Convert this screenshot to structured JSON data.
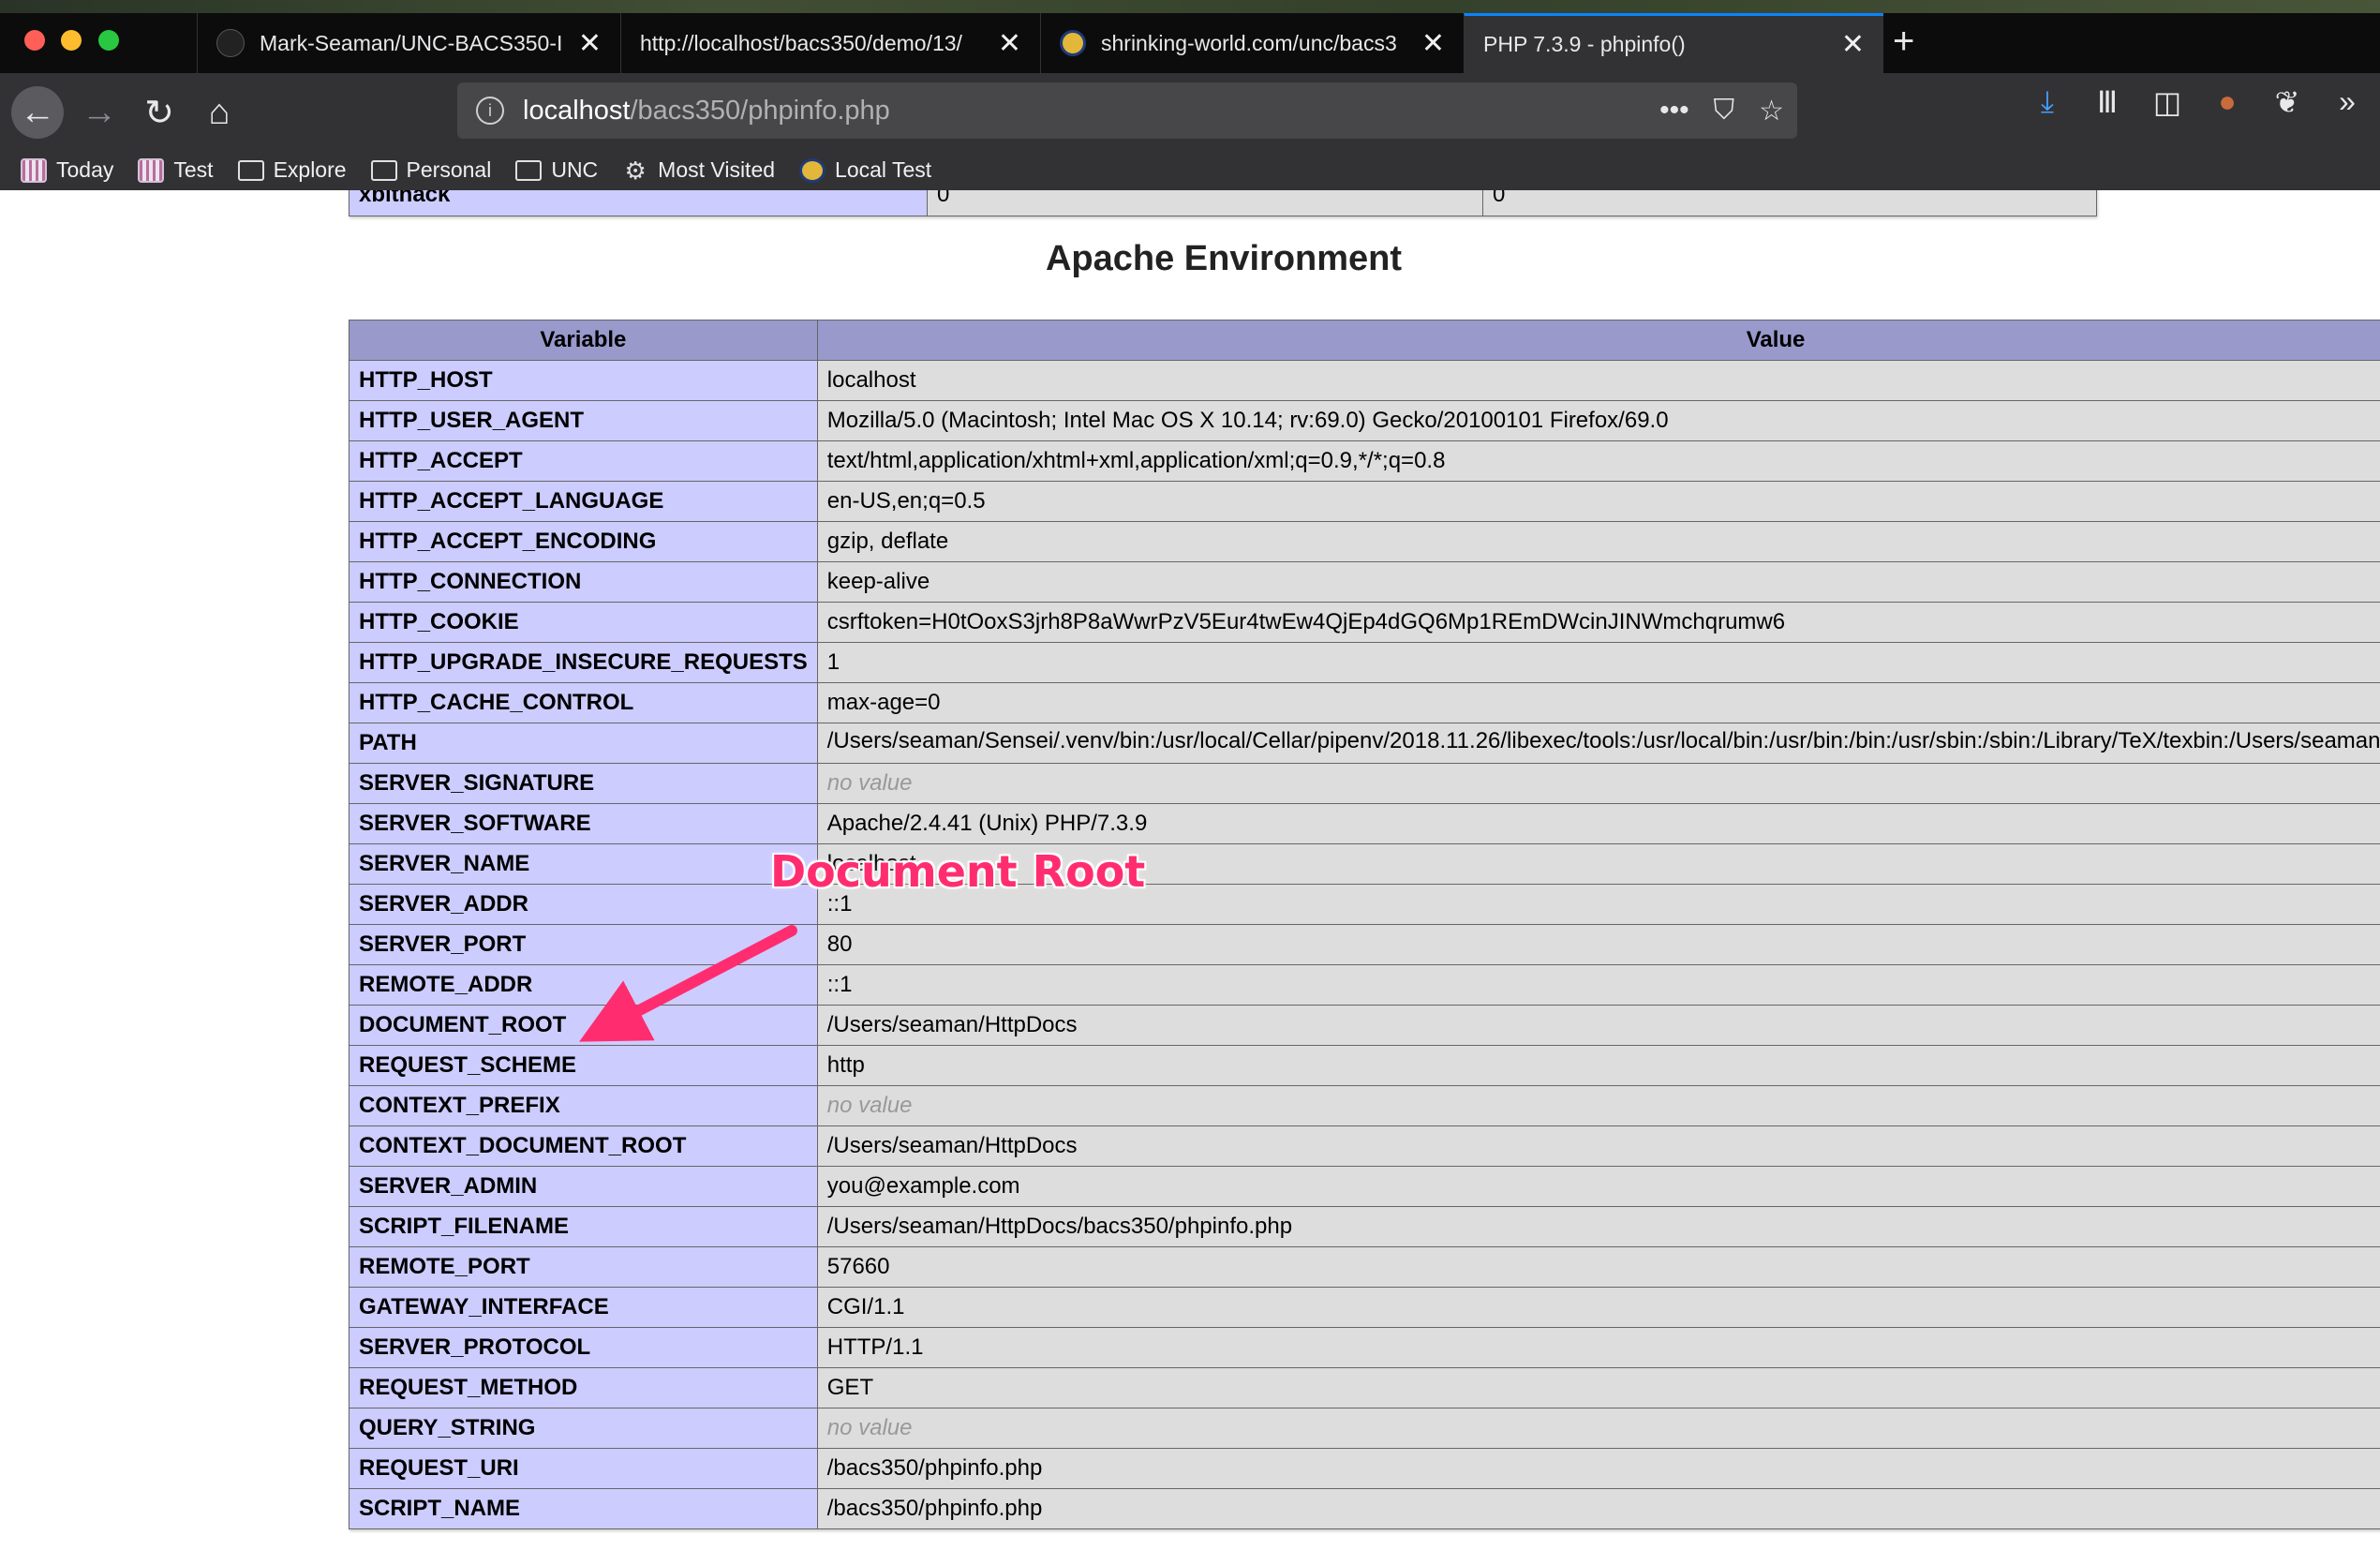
{
  "browser": {
    "tabs": [
      {
        "title": "Mark-Seaman/UNC-BACS350-I",
        "close": "✕"
      },
      {
        "title": "http://localhost/bacs350/demo/13/",
        "close": "✕"
      },
      {
        "title": "shrinking-world.com/unc/bacs3",
        "close": "✕"
      },
      {
        "title": "PHP 7.3.9 - phpinfo()",
        "close": "✕",
        "active": true
      }
    ],
    "new_tab": "+",
    "url_host": "localhost",
    "url_path": "/bacs350/phpinfo.php",
    "bookmarks": [
      {
        "label": "Today",
        "icon": "globe-icon"
      },
      {
        "label": "Test",
        "icon": "globe-icon"
      },
      {
        "label": "Explore",
        "icon": "folder-icon"
      },
      {
        "label": "Personal",
        "icon": "folder-icon"
      },
      {
        "label": "UNC",
        "icon": "folder-icon"
      },
      {
        "label": "Most Visited",
        "icon": "gear-icon"
      },
      {
        "label": "Local Test",
        "icon": "badge-icon"
      }
    ]
  },
  "prev_row": {
    "name": "xbithack",
    "local": "0",
    "master": "0"
  },
  "section": {
    "title": "Apache Environment"
  },
  "table": {
    "headers": [
      "Variable",
      "Value"
    ],
    "rows": [
      {
        "name": "HTTP_HOST",
        "value": "localhost"
      },
      {
        "name": "HTTP_USER_AGENT",
        "value": "Mozilla/5.0 (Macintosh; Intel Mac OS X 10.14; rv:69.0) Gecko/20100101 Firefox/69.0"
      },
      {
        "name": "HTTP_ACCEPT",
        "value": "text/html,application/xhtml+xml,application/xml;q=0.9,*/*;q=0.8"
      },
      {
        "name": "HTTP_ACCEPT_LANGUAGE",
        "value": "en-US,en;q=0.5"
      },
      {
        "name": "HTTP_ACCEPT_ENCODING",
        "value": "gzip, deflate"
      },
      {
        "name": "HTTP_CONNECTION",
        "value": "keep-alive"
      },
      {
        "name": "HTTP_COOKIE",
        "value": "csrftoken=H0tOoxS3jrh8P8aWwrPzV5Eur4twEw4QjEp4dGQ6Mp1REmDWcinJINWmchqrumw6"
      },
      {
        "name": "HTTP_UPGRADE_INSECURE_REQUESTS",
        "value": "1"
      },
      {
        "name": "HTTP_CACHE_CONTROL",
        "value": "max-age=0"
      },
      {
        "name": "PATH",
        "value": "/Users/seaman/Sensei/.venv/bin:/usr/local/Cellar/pipenv/2018.11.26/libexec/tools:/usr/local/bin:/usr/bin:/bin:/usr/sbin:/sbin:/Library/TeX/texbin:/Users/seaman/Sensei:/Users/seaman/Sensei/bin",
        "tall": true
      },
      {
        "name": "SERVER_SIGNATURE",
        "value": "no value",
        "novalue": true
      },
      {
        "name": "SERVER_SOFTWARE",
        "value": "Apache/2.4.41 (Unix) PHP/7.3.9"
      },
      {
        "name": "SERVER_NAME",
        "value": "localhost"
      },
      {
        "name": "SERVER_ADDR",
        "value": "::1"
      },
      {
        "name": "SERVER_PORT",
        "value": "80"
      },
      {
        "name": "REMOTE_ADDR",
        "value": "::1"
      },
      {
        "name": "DOCUMENT_ROOT",
        "value": "/Users/seaman/HttpDocs"
      },
      {
        "name": "REQUEST_SCHEME",
        "value": "http"
      },
      {
        "name": "CONTEXT_PREFIX",
        "value": "no value",
        "novalue": true
      },
      {
        "name": "CONTEXT_DOCUMENT_ROOT",
        "value": "/Users/seaman/HttpDocs"
      },
      {
        "name": "SERVER_ADMIN",
        "value": "you@example.com"
      },
      {
        "name": "SCRIPT_FILENAME",
        "value": "/Users/seaman/HttpDocs/bacs350/phpinfo.php"
      },
      {
        "name": "REMOTE_PORT",
        "value": "57660"
      },
      {
        "name": "GATEWAY_INTERFACE",
        "value": "CGI/1.1"
      },
      {
        "name": "SERVER_PROTOCOL",
        "value": "HTTP/1.1"
      },
      {
        "name": "REQUEST_METHOD",
        "value": "GET"
      },
      {
        "name": "QUERY_STRING",
        "value": "no value",
        "novalue": true
      },
      {
        "name": "REQUEST_URI",
        "value": "/bacs350/phpinfo.php"
      },
      {
        "name": "SCRIPT_NAME",
        "value": "/bacs350/phpinfo.php"
      }
    ]
  },
  "annotation": {
    "text": "Document Root",
    "color": "#ff2d6f"
  },
  "colors": {
    "header_bg": "#9999cc",
    "name_bg": "#ccccff",
    "value_bg": "#dddddd",
    "accent": "#0a84ff"
  }
}
